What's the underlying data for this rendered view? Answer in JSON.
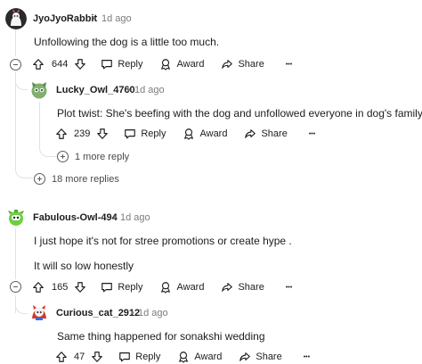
{
  "comments": [
    {
      "author": "JyoJyoRabbit",
      "time": "1d ago",
      "body": [
        "Unfollowing the dog is a little too much."
      ],
      "votes": "644",
      "reply_label": "Reply",
      "award_label": "Award",
      "share_label": "Share",
      "more_label": "•••",
      "collapse_label": "−",
      "more_replies": "18 more replies",
      "reply": {
        "author": "Lucky_Owl_4760",
        "time": "1d ago",
        "body": [
          "Plot twist: She's beefing with the dog and unfollowed everyone in dog's family."
        ],
        "votes": "239",
        "reply_label": "Reply",
        "award_label": "Award",
        "share_label": "Share",
        "more_label": "•••",
        "more_replies": "1 more reply"
      }
    },
    {
      "author": "Fabulous-Owl-494",
      "time": "1d ago",
      "body": [
        "I just hope it's not for stree promotions or create hype .",
        "It will so low honestly"
      ],
      "votes": "165",
      "reply_label": "Reply",
      "award_label": "Award",
      "share_label": "Share",
      "more_label": "•••",
      "collapse_label": "−",
      "reply": {
        "author": "Curious_cat_2912",
        "time": "1d ago",
        "body": [
          "Same thing happened for sonakshi wedding"
        ],
        "votes": "47",
        "reply_label": "Reply",
        "award_label": "Award",
        "share_label": "Share",
        "more_label": "•••"
      }
    }
  ],
  "separator": "•",
  "icons": [
    "upvote-icon",
    "downvote-icon",
    "comment-bubble-icon",
    "award-icon",
    "share-icon",
    "more-options-icon",
    "collapse-thread-icon",
    "expand-thread-icon"
  ]
}
